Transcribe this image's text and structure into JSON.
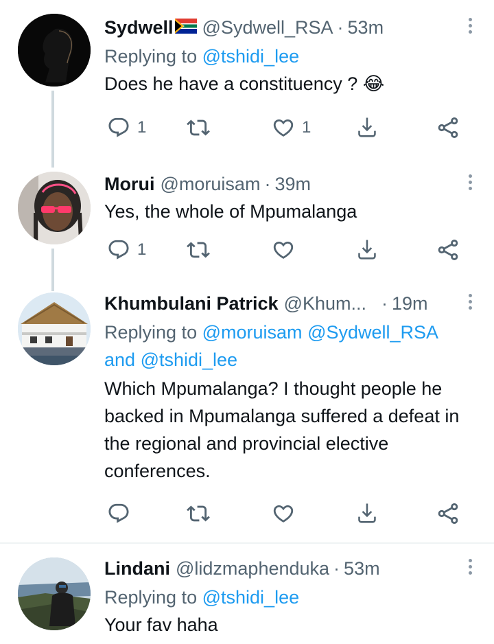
{
  "tweets": [
    {
      "name": "Sydwell",
      "handle": "@Sydwell_RSA",
      "dot": "·",
      "time": "53m",
      "reply_prefix": "Replying to",
      "reply_mention": "@tshidi_lee",
      "text": "Does he have a constituency ? 😂",
      "reply_count": "1",
      "like_count": "1"
    },
    {
      "name": "Morui",
      "handle": "@moruisam",
      "dot": "·",
      "time": "39m",
      "text": "Yes, the whole of Mpumalanga",
      "reply_count": "1"
    },
    {
      "name": "Khumbulani Patrick",
      "handle": "@Khum...",
      "dot": "·",
      "time": "19m",
      "reply_prefix": "Replying to",
      "reply_mention_1": "@moruisam",
      "reply_mention_2": "@Sydwell_RSA",
      "reply_and": "and",
      "reply_mention_3": "@tshidi_lee",
      "text": "Which Mpumalanga? I thought people he backed in Mpumalanga suffered a defeat in the regional and provincial elective conferences."
    },
    {
      "name": "Lindani",
      "handle": "@lidzmaphenduka",
      "dot": "·",
      "time": "53m",
      "reply_prefix": "Replying to",
      "reply_mention": "@tshidi_lee",
      "text": "Your fav haha"
    }
  ],
  "colors": {
    "link": "#1d9bf0",
    "secondary": "#536471",
    "thread_line": "#cfd9de"
  }
}
